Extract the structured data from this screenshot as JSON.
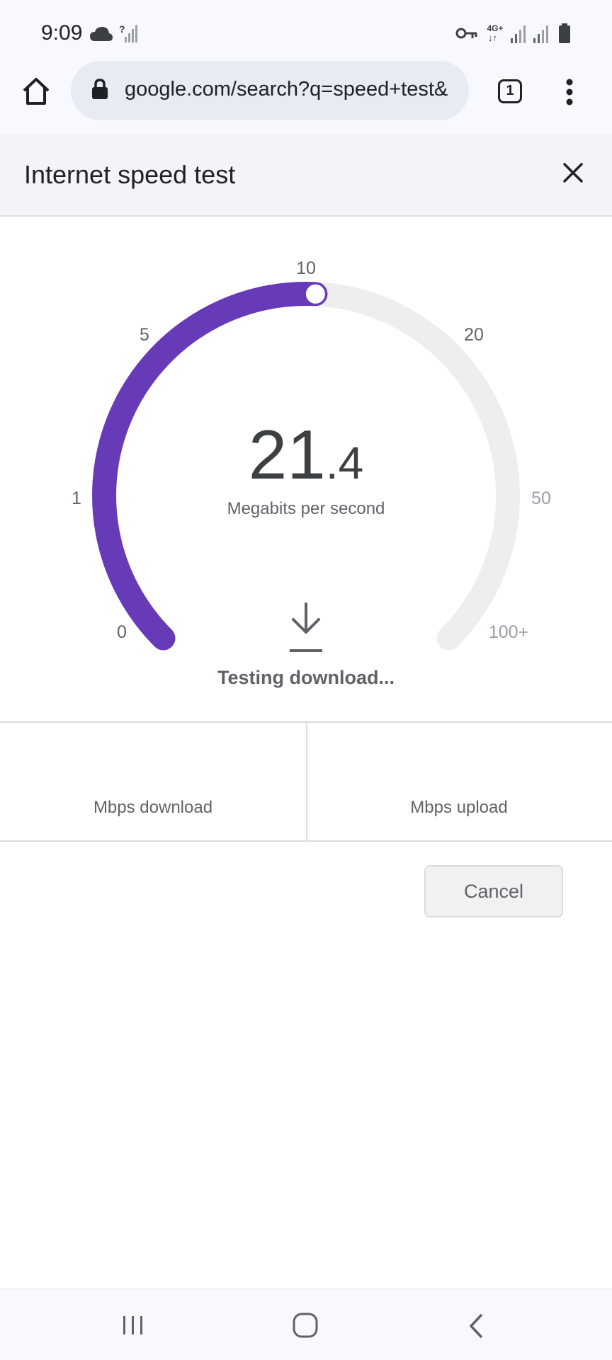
{
  "status_bar": {
    "time": "9:09",
    "left_icons": [
      "cloud-icon",
      "no-signal-icon"
    ],
    "network_label": "4G+",
    "right_icons": [
      "vpn-key-icon",
      "signal-icon",
      "signal-icon",
      "battery-icon"
    ]
  },
  "browser": {
    "url": "google.com/search?q=speed+test&",
    "tab_count": "1"
  },
  "dialog": {
    "title": "Internet speed test"
  },
  "gauge": {
    "ticks": [
      "0",
      "1",
      "5",
      "10",
      "20",
      "50",
      "100+"
    ],
    "value_int": "21",
    "value_dec": ".4",
    "unit": "Megabits per second",
    "status": "Testing download...",
    "progress_fraction": 0.51,
    "accent_color": "#673ab7",
    "track_color": "#eeeeee"
  },
  "results": {
    "download_label": "Mbps download",
    "upload_label": "Mbps upload"
  },
  "actions": {
    "cancel_label": "Cancel"
  }
}
